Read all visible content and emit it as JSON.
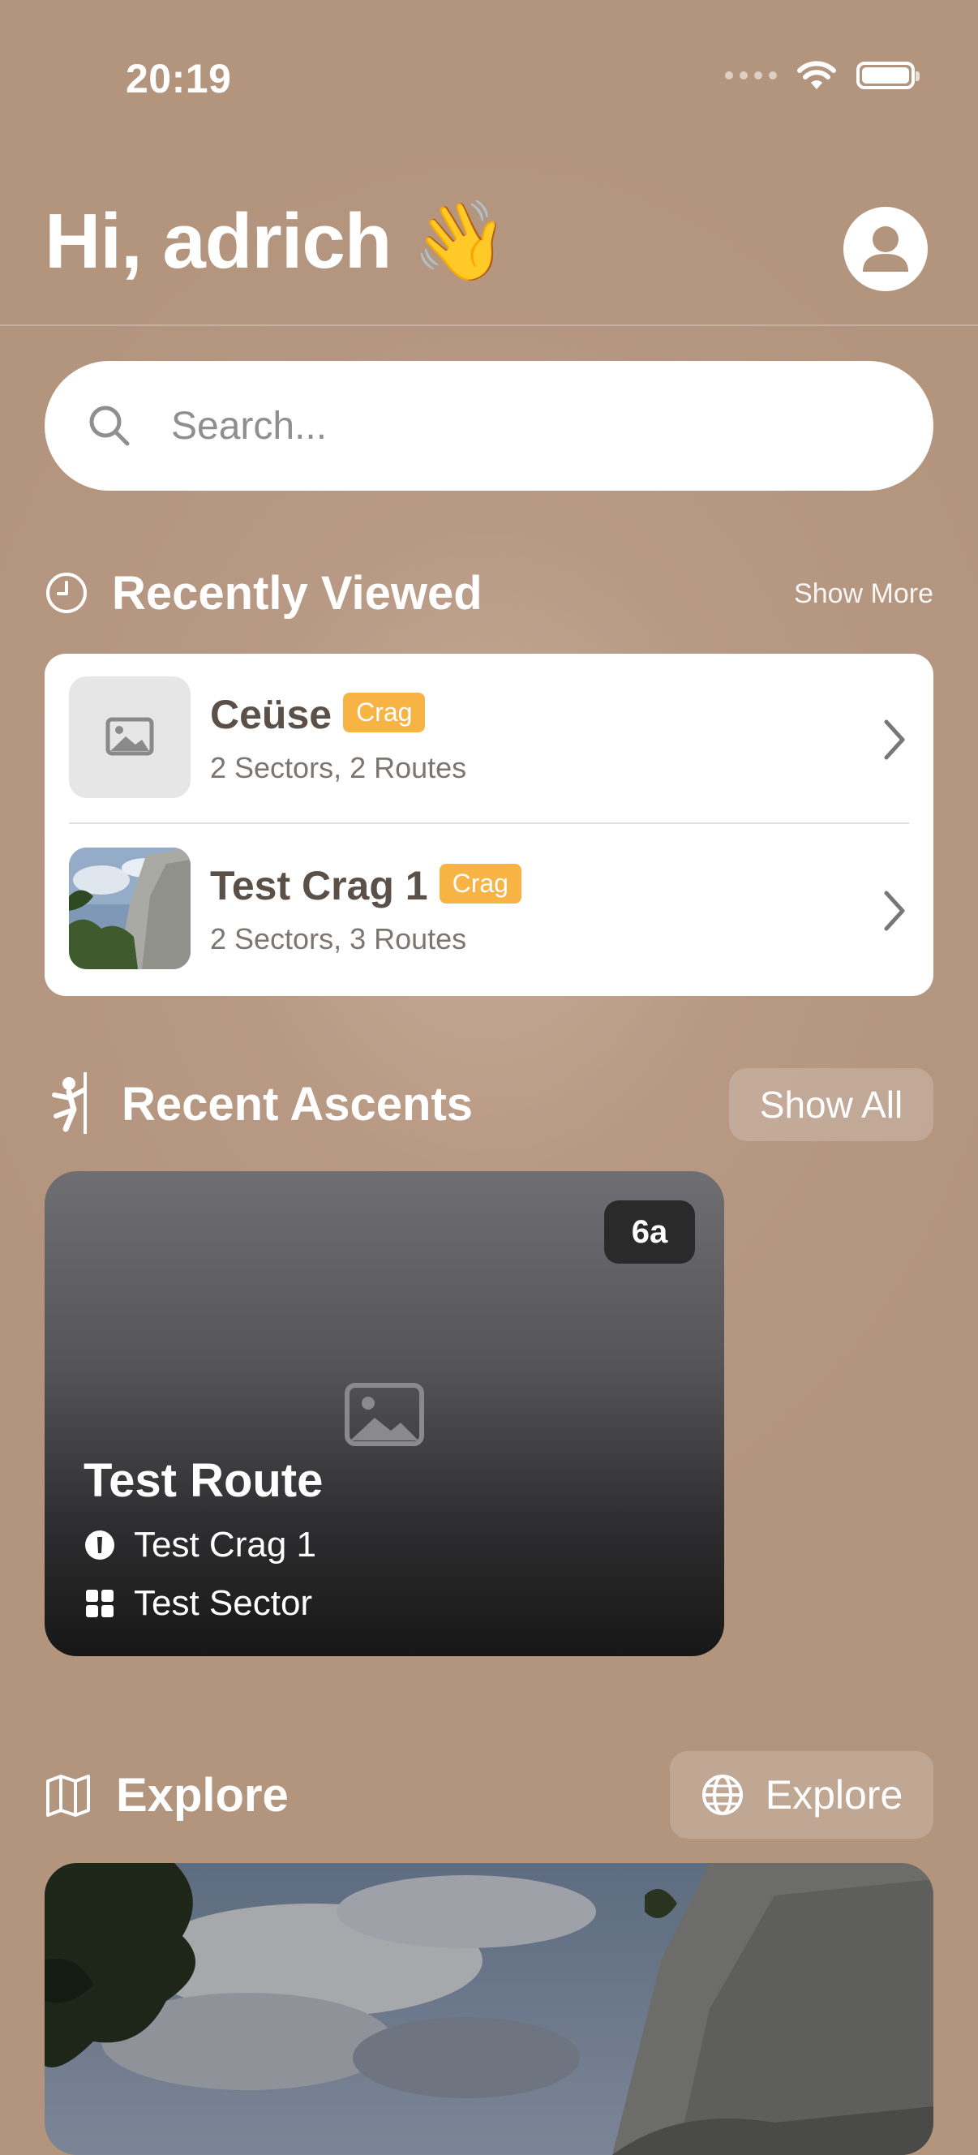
{
  "status_bar": {
    "time": "20:19"
  },
  "header": {
    "greeting": "Hi, adrich 👋"
  },
  "search": {
    "placeholder": "Search..."
  },
  "recently_viewed": {
    "title": "Recently Viewed",
    "show_more_label": "Show More",
    "items": [
      {
        "name": "Ceüse",
        "badge": "Crag",
        "subtitle": "2 Sectors, 2 Routes"
      },
      {
        "name": "Test Crag 1",
        "badge": "Crag",
        "subtitle": "2 Sectors, 3 Routes"
      }
    ]
  },
  "recent_ascents": {
    "title": "Recent Ascents",
    "show_all_label": "Show All",
    "items": [
      {
        "grade": "6a",
        "route": "Test Route",
        "crag": "Test Crag 1",
        "sector": "Test Sector"
      }
    ]
  },
  "explore": {
    "title": "Explore",
    "button_label": "Explore"
  },
  "colors": {
    "background": "#b89984",
    "badge": "#f7b445",
    "card": "#ffffff"
  }
}
